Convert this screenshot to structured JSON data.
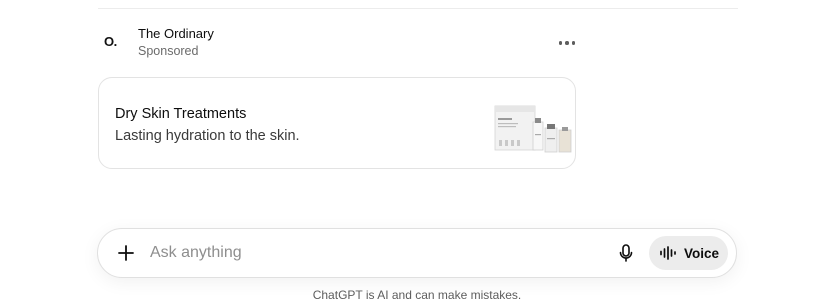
{
  "sponsor": {
    "logo_text": "O.",
    "name": "The Ordinary",
    "label": "Sponsored"
  },
  "ad": {
    "title": "Dry Skin Treatments",
    "description": "Lasting hydration to the skin."
  },
  "composer": {
    "placeholder": "Ask anything",
    "voice_label": "Voice"
  },
  "footer": {
    "disclaimer": "ChatGPT is AI and can make mistakes."
  },
  "icons": {
    "plus": "plus-icon",
    "more": "more-horizontal-icon",
    "mic": "microphone-icon",
    "voice": "voice-waveform-icon"
  },
  "colors": {
    "voice_bg": "#ececec",
    "border": "#e3e3e3",
    "muted_text": "#6b6b6b"
  }
}
